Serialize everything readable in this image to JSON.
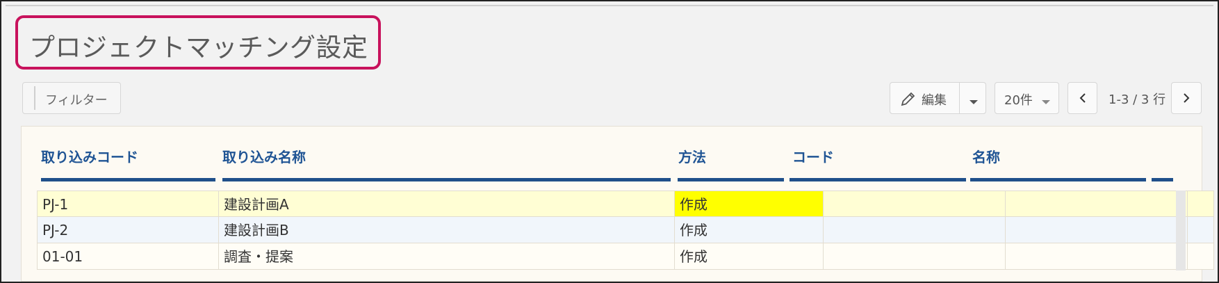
{
  "page": {
    "title": "プロジェクトマッチング設定"
  },
  "toolbar": {
    "filter_label": "フィルター",
    "edit_label": "編集",
    "per_page_label": "20件",
    "range_label": "1-3 / 3 行"
  },
  "table": {
    "headers": [
      "取り込みコード",
      "取り込み名称",
      "方法",
      "コード",
      "名称"
    ],
    "rows": [
      {
        "code": "PJ-1",
        "name": "建設計画A",
        "method": "作成",
        "target_code": "",
        "target_name": "",
        "highlight": "#fffed4",
        "method_highlight": "#ffff00"
      },
      {
        "code": "PJ-2",
        "name": "建設計画B",
        "method": "作成",
        "target_code": "",
        "target_name": "",
        "highlight": "#f1f6fb"
      },
      {
        "code": "01-01",
        "name": "調査・提案",
        "method": "作成",
        "target_code": "",
        "target_name": "",
        "highlight": "#fffdf6"
      }
    ]
  },
  "colors": {
    "accent_border": "#c8125c",
    "header_text": "#1f5494",
    "header_rule": "#1f4f8a"
  },
  "icons": [
    "pencil-icon",
    "caret-down-icon",
    "chevron-left-icon",
    "chevron-right-icon"
  ]
}
